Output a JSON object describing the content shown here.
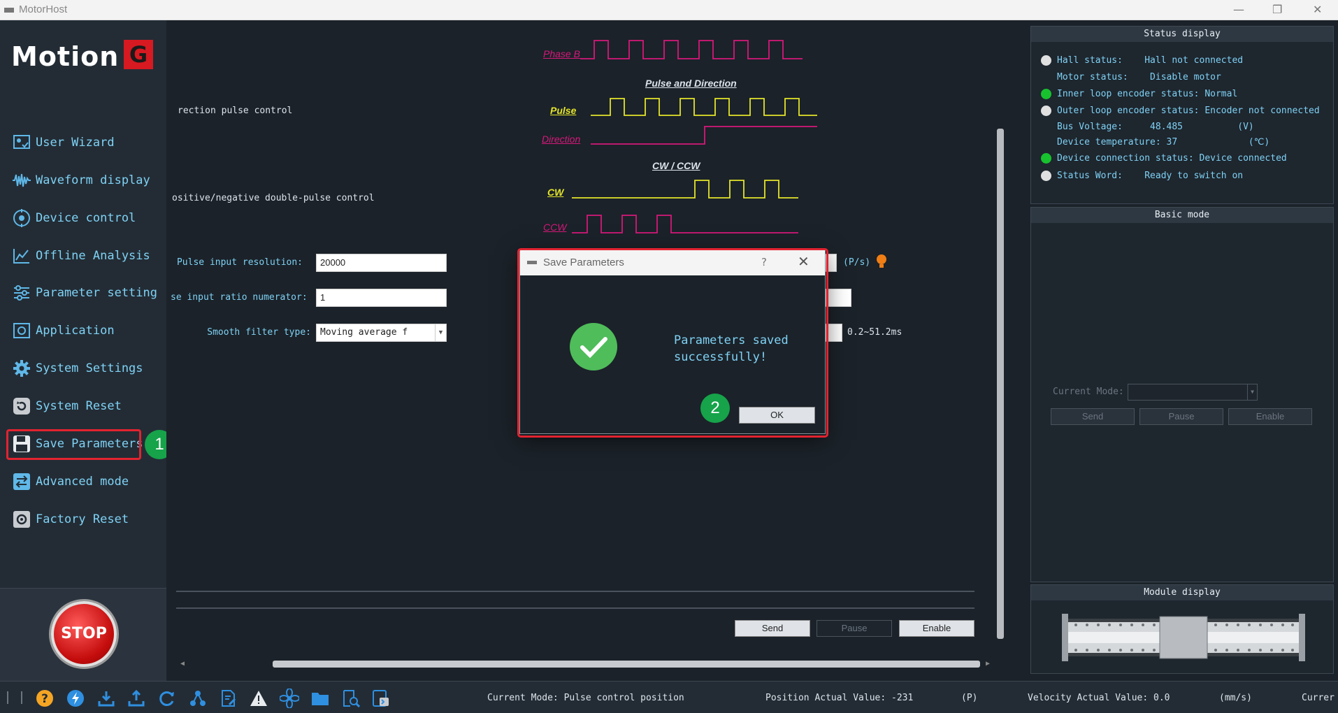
{
  "window": {
    "title": "MotorHost",
    "minimize": "—",
    "maximize": "❐",
    "close": "✕"
  },
  "logo": {
    "word": "Motion",
    "letter": "G"
  },
  "sidebar": {
    "items": [
      {
        "label": "User Wizard",
        "icon": "user-wizard-icon"
      },
      {
        "label": "Waveform display",
        "icon": "waveform-icon"
      },
      {
        "label": "Device control",
        "icon": "device-control-icon"
      },
      {
        "label": "Offline Analysis",
        "icon": "offline-analysis-icon"
      },
      {
        "label": "Parameter setting",
        "icon": "parameter-setting-icon"
      },
      {
        "label": "Application",
        "icon": "application-icon"
      },
      {
        "label": "System Settings",
        "icon": "gear-icon"
      },
      {
        "label": "System Reset",
        "icon": "reset-icon"
      },
      {
        "label": "Save Parameters",
        "icon": "save-icon"
      },
      {
        "label": "Advanced mode",
        "icon": "advanced-mode-icon"
      },
      {
        "label": "Factory Reset",
        "icon": "factory-reset-icon"
      }
    ],
    "stop_label": "STOP"
  },
  "annotations": {
    "badge1": "1",
    "badge2": "2"
  },
  "main": {
    "option_text_1": "rection pulse control",
    "option_text_2": "ositive/negative double-pulse control",
    "waves": {
      "phase_b": "Phase B",
      "pulse_dir_title": "Pulse and Direction",
      "pulse": "Pulse",
      "direction": "Direction",
      "cw_ccw_title": "CW / CCW",
      "cw": "CW",
      "ccw": "CCW"
    },
    "fields": {
      "resolution_label": "Pulse input resolution:",
      "resolution_value": "20000",
      "numerator_label": "se input ratio numerator:",
      "numerator_value": "1",
      "filter_label": "Smooth filter type:",
      "filter_value": "Moving average f",
      "ps_unit": "(P/s)",
      "filter_range": "0.2~51.2ms"
    },
    "buttons": {
      "send": "Send",
      "pause": "Pause",
      "enable": "Enable"
    }
  },
  "dialog": {
    "title": "Save Parameters",
    "help": "?",
    "close": "✕",
    "message": "Parameters saved successfully!",
    "ok": "OK"
  },
  "status_display": {
    "title": "Status display",
    "rows": [
      {
        "dot": "gray",
        "text": "Hall status:    Hall not connected"
      },
      {
        "dot": "none",
        "text": "Motor status:    Disable motor"
      },
      {
        "dot": "green",
        "text": "Inner loop encoder status: Normal"
      },
      {
        "dot": "gray",
        "text": "Outer loop encoder status: Encoder not connected"
      },
      {
        "dot": "none",
        "text": "Bus Voltage:     48.485          (V)"
      },
      {
        "dot": "none",
        "text": "Device temperature: 37             (℃)"
      },
      {
        "dot": "green",
        "text": "Device connection status: Device connected"
      },
      {
        "dot": "gray",
        "text": "Status Word:    Ready to switch on"
      }
    ]
  },
  "basic_mode": {
    "title": "Basic mode",
    "current_mode_label": "Current Mode:",
    "send": "Send",
    "pause": "Pause",
    "enable": "Enable"
  },
  "module_display": {
    "title": "Module display"
  },
  "statusbar": {
    "current_mode": "Current Mode: Pulse control position",
    "position": "Position Actual Value: -231",
    "position_unit": "(P)",
    "velocity": "Velocity Actual Value: 0.0",
    "velocity_unit": "(mm/s)",
    "current": "Currer"
  },
  "colors": {
    "accent": "#7fd2f5",
    "highlight": "#e22330",
    "badge": "#16a34a",
    "wave_magenta": "#d6187a",
    "wave_yellow": "#e4e42a"
  }
}
